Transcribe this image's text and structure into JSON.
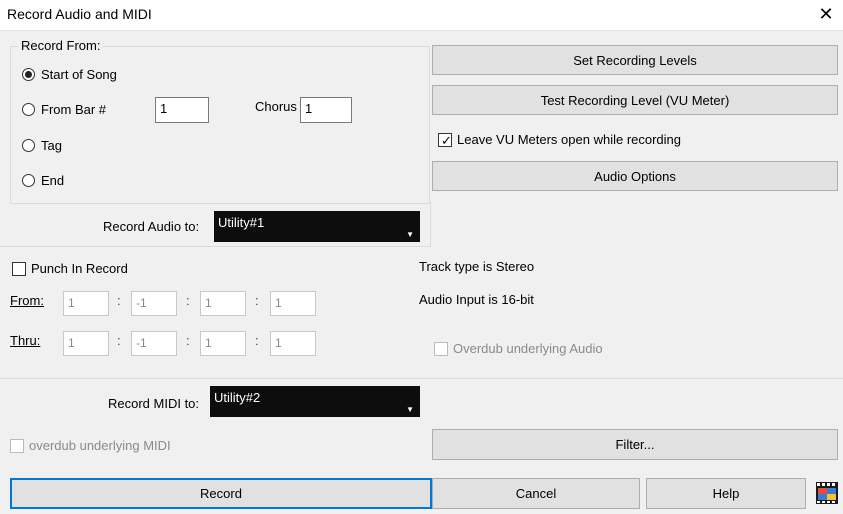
{
  "window": {
    "title": "Record Audio and MIDI"
  },
  "record_from": {
    "group_label": "Record From:",
    "options": [
      "Start of Song",
      "From Bar #",
      "Tag",
      "End"
    ],
    "selected": "Start of Song",
    "bar_value": "1",
    "chorus_label": "Chorus",
    "chorus_value": "1"
  },
  "right_panel": {
    "set_levels": "Set Recording Levels",
    "test_level": "Test Recording Level (VU Meter)",
    "leave_vu_label": "Leave VU Meters open while recording",
    "leave_vu_checked": true,
    "audio_options": "Audio Options"
  },
  "record_audio": {
    "label": "Record Audio to:",
    "value": "Utility#1"
  },
  "punch": {
    "label": "Punch In Record",
    "checked": false,
    "from_label": "From:",
    "thru_label": "Thru:",
    "from_values": [
      "1",
      "-1",
      "1",
      "1"
    ],
    "thru_values": [
      "1",
      "-1",
      "1",
      "1"
    ]
  },
  "audio_info": {
    "track_type": "Track type is Stereo",
    "audio_input": "Audio Input is 16-bit",
    "overdub_audio": "Overdub underlying Audio"
  },
  "record_midi": {
    "label": "Record MIDI to:",
    "value": "Utility#2",
    "overdub_midi": "overdub underlying MIDI",
    "filter": "Filter..."
  },
  "footer": {
    "record": "Record",
    "cancel": "Cancel",
    "help": "Help"
  },
  "colors": {
    "accent": "#0078d7",
    "dropdown_bg": "#0d0d0d",
    "dialog_bg": "#f0f0f0"
  }
}
